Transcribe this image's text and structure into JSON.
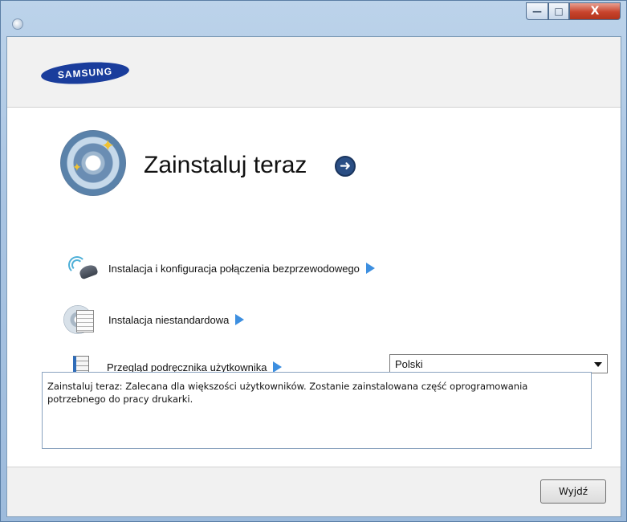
{
  "window": {
    "title": "",
    "minimize_label": "—",
    "maximize_label": "□",
    "close_label": "X"
  },
  "header": {
    "logo_text": "SAMSUNG",
    "brand_color": "#1a3d9c"
  },
  "main": {
    "heading": "Zainstaluj teraz",
    "go_glyph": "➜",
    "options": [
      {
        "label": "Instalacja i konfiguracja połączenia bezprzewodowego",
        "icon": "wireless-dish-icon"
      },
      {
        "label": "Instalacja niestandardowa",
        "icon": "cd-document-icon"
      },
      {
        "label": "Przegląd podręcznika użytkownika",
        "icon": "manual-book-icon"
      }
    ],
    "language": {
      "selected": "Polski"
    },
    "description": "Zainstaluj teraz: Zalecana dla większości użytkowników. Zostanie zainstalowana część oprogramowania potrzebnego do pracy drukarki."
  },
  "footer": {
    "exit_label": "Wyjdź"
  },
  "colors": {
    "accent_arrow": "#3d8fe0",
    "go_button": "#2a4e84",
    "close_button": "#c8442d"
  }
}
